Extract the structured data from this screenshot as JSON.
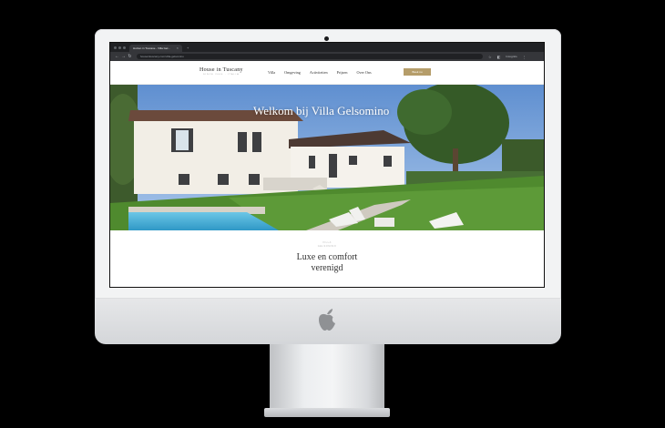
{
  "browser": {
    "tab_title": "Huizen in Toscane - Villa Gel...",
    "tab_close": "×",
    "new_tab": "+",
    "url": "houseintuscany.com/villa-gelsomino",
    "back": "←",
    "forward": "→",
    "reload": "↻",
    "incognito_label": "Incognito"
  },
  "site": {
    "logo": {
      "main": "House in Tuscany",
      "sub": "SINCE 2004 · ITALIA"
    },
    "nav": [
      "Villa",
      "Omgeving",
      "Activiteiten",
      "Prijzen",
      "Over Ons"
    ],
    "cta_label": "Boek nu",
    "hero_title": "Welkom bij Villa Gelsomino",
    "intro": {
      "eyebrow_1": "VILLA",
      "eyebrow_2": "GELSOMINO",
      "title_line_1": "Luxe en comfort",
      "title_line_2": "verenigd"
    }
  },
  "colors": {
    "accent": "#b59d6a",
    "chrome_dark": "#202124",
    "chrome_mid": "#35363a"
  }
}
